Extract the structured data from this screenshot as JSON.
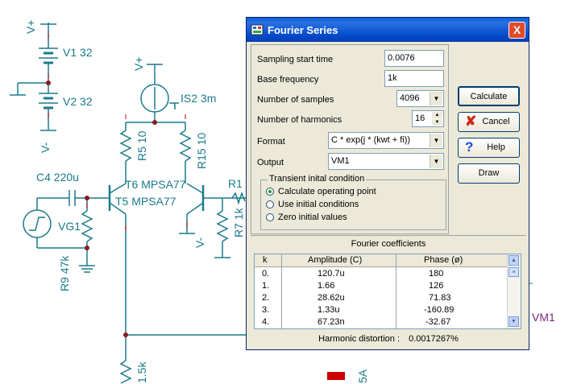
{
  "schematic": {
    "labels": {
      "v_plus_1": "V+",
      "v1": "V1 32",
      "v2": "V2 32",
      "v_minus_1": "V-",
      "v_plus_2": "V+",
      "is2": "IS2 3m",
      "r5": "R5 10",
      "r15": "R15 10",
      "c4": "C4 220u",
      "t6": "T6 MPSA77",
      "t5": "T5 MPSA77",
      "r1_partial": "R1",
      "vg1": "VG1",
      "r9": "R9 47k",
      "v_minus_2": "V-",
      "r7": "R7 1k",
      "r_bottom": "1.5k",
      "vm1": "VM1",
      "bottom_partial": "5A"
    }
  },
  "dialog": {
    "title": "Fourier Series",
    "close_glyph": "X",
    "fields": {
      "sampling_start_label": "Sampling start time",
      "sampling_start_value": "0.0076",
      "base_freq_label": "Base frequency",
      "base_freq_value": "1k",
      "num_samples_label": "Number of samples",
      "num_samples_value": "4096",
      "num_harmonics_label": "Number of harmonics",
      "num_harmonics_value": "16",
      "format_label": "Format",
      "format_value": "C * exp(j * (kwt + fi))",
      "output_label": "Output",
      "output_value": "VM1"
    },
    "transient": {
      "title": "Transient inital condition",
      "options": [
        "Calculate operating point",
        "Use initial conditions",
        "Zero initial values"
      ],
      "selected_index": 0
    },
    "buttons": {
      "calculate": "Calculate",
      "cancel": "Cancel",
      "help": "Help",
      "draw": "Draw"
    },
    "coefficients": {
      "title": "Fourier coefficients",
      "headers": [
        "k",
        "Amplitude (C)",
        "Phase (ø)"
      ],
      "rows": [
        [
          "0.",
          "120.7u",
          "180"
        ],
        [
          "1.",
          "1.66",
          "126"
        ],
        [
          "2.",
          "28.62u",
          "71.83"
        ],
        [
          "3.",
          "1.33u",
          "-160.89"
        ],
        [
          "4.",
          "67.23n",
          "-32.67"
        ]
      ]
    },
    "harmonic_distortion_label": "Harmonic distortion :",
    "harmonic_distortion_value": "0.0017267%"
  }
}
